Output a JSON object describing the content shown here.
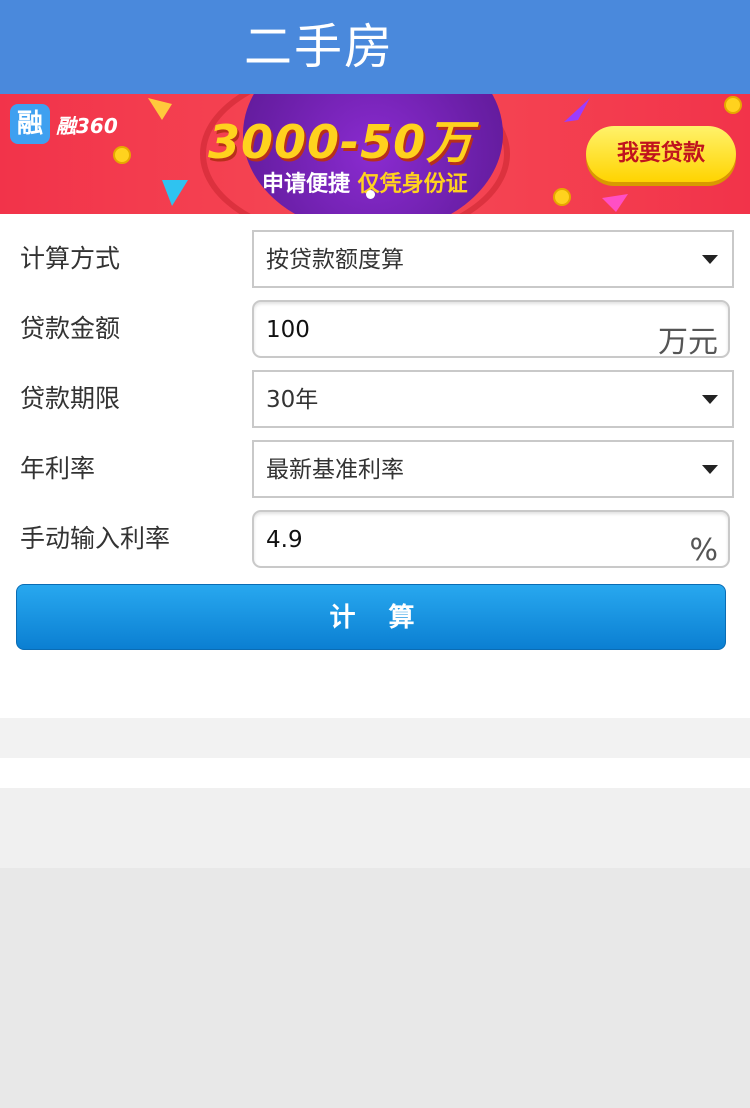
{
  "header": {
    "title": "二手房"
  },
  "banner": {
    "brand_glyph": "融",
    "brand_text": "融360",
    "amount": "3000-50万",
    "subline_part1": "申请便捷 ",
    "subline_part2": "仅凭身份证",
    "cta_label": "我要贷款",
    "colors": {
      "background": "#f2334a",
      "accent": "#ffd21e",
      "circle": "#6b1fa8"
    }
  },
  "form": {
    "calc_method": {
      "label": "计算方式",
      "value": "按贷款额度算"
    },
    "loan_amount": {
      "label": "贷款金额",
      "value": "100",
      "unit": "万元"
    },
    "loan_term": {
      "label": "贷款期限",
      "value": "30年"
    },
    "annual_rate": {
      "label": "年利率",
      "value": "最新基准利率"
    },
    "manual_rate": {
      "label": "手动输入利率",
      "value": "4.9",
      "unit": "%"
    },
    "calculate_label": "计 算"
  },
  "colors": {
    "header": "#4a89dc",
    "button": "#1692e0"
  }
}
